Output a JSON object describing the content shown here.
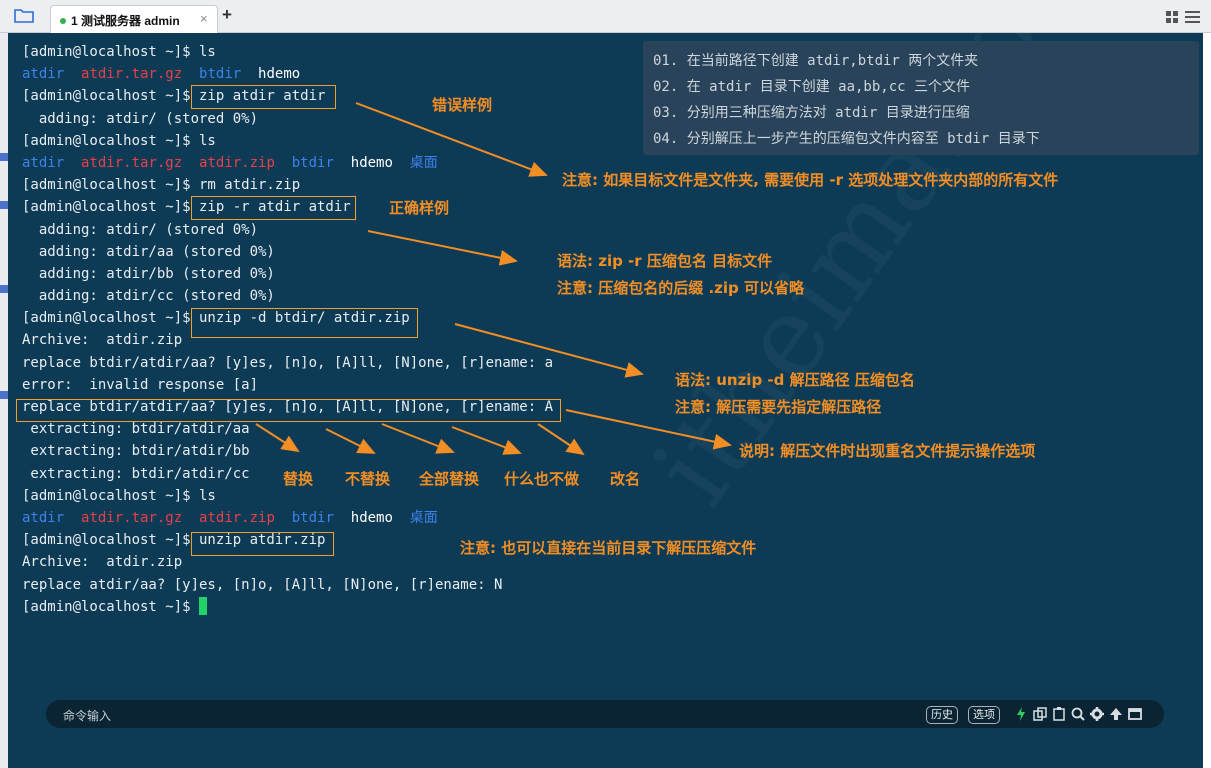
{
  "tabbar": {
    "tab_title": "1 测试服务器 admin",
    "close_symbol": "×",
    "add_symbol": "+"
  },
  "terminal": {
    "lines": [
      [
        {
          "t": "[admin@localhost ~]$ ls"
        }
      ],
      [
        {
          "t": "atdir",
          "c": "blu"
        },
        {
          "t": "  "
        },
        {
          "t": "atdir.tar.gz",
          "c": "red"
        },
        {
          "t": "  "
        },
        {
          "t": "btdir",
          "c": "blu"
        },
        {
          "t": "  "
        },
        {
          "t": "hdemo",
          "c": "wht"
        }
      ],
      [
        {
          "t": "[admin@localhost ~]$ zip atdir atdir"
        }
      ],
      [
        {
          "t": "  adding: atdir/ (stored 0%)"
        }
      ],
      [
        {
          "t": "[admin@localhost ~]$ ls"
        }
      ],
      [
        {
          "t": "atdir",
          "c": "blu"
        },
        {
          "t": "  "
        },
        {
          "t": "atdir.tar.gz",
          "c": "red"
        },
        {
          "t": "  "
        },
        {
          "t": "atdir.zip",
          "c": "red"
        },
        {
          "t": "  "
        },
        {
          "t": "btdir",
          "c": "blu"
        },
        {
          "t": "  "
        },
        {
          "t": "hdemo",
          "c": "wht"
        },
        {
          "t": "  "
        },
        {
          "t": "桌面",
          "c": "blu"
        }
      ],
      [
        {
          "t": "[admin@localhost ~]$ rm atdir.zip"
        }
      ],
      [
        {
          "t": "[admin@localhost ~]$ zip -r atdir atdir"
        }
      ],
      [
        {
          "t": "  adding: atdir/ (stored 0%)"
        }
      ],
      [
        {
          "t": "  adding: atdir/aa (stored 0%)"
        }
      ],
      [
        {
          "t": "  adding: atdir/bb (stored 0%)"
        }
      ],
      [
        {
          "t": "  adding: atdir/cc (stored 0%)"
        }
      ],
      [
        {
          "t": "[admin@localhost ~]$ unzip -d btdir/ atdir.zip"
        }
      ],
      [
        {
          "t": "Archive:  atdir.zip"
        }
      ],
      [
        {
          "t": "replace btdir/atdir/aa? [y]es, [n]o, [A]ll, [N]one, [r]ename: a"
        }
      ],
      [
        {
          "t": "error:  invalid response [a]"
        }
      ],
      [
        {
          "t": "replace btdir/atdir/aa? [y]es, [n]o, [A]ll, [N]one, [r]ename: A"
        }
      ],
      [
        {
          "t": " extracting: btdir/atdir/aa"
        }
      ],
      [
        {
          "t": " extracting: btdir/atdir/bb"
        }
      ],
      [
        {
          "t": " extracting: btdir/atdir/cc"
        }
      ],
      [
        {
          "t": "[admin@localhost ~]$ ls"
        }
      ],
      [
        {
          "t": "atdir",
          "c": "blu"
        },
        {
          "t": "  "
        },
        {
          "t": "atdir.tar.gz",
          "c": "red"
        },
        {
          "t": "  "
        },
        {
          "t": "atdir.zip",
          "c": "red"
        },
        {
          "t": "  "
        },
        {
          "t": "btdir",
          "c": "blu"
        },
        {
          "t": "  "
        },
        {
          "t": "hdemo",
          "c": "wht"
        },
        {
          "t": "  "
        },
        {
          "t": "桌面",
          "c": "blu"
        }
      ],
      [
        {
          "t": "[admin@localhost ~]$ unzip atdir.zip"
        }
      ],
      [
        {
          "t": "Archive:  atdir.zip"
        }
      ],
      [
        {
          "t": "replace atdir/aa? [y]es, [n]o, [A]ll, [N]one, [r]ename: N"
        }
      ],
      [
        {
          "t": "[admin@localhost ~]$ "
        }
      ]
    ]
  },
  "info_box": {
    "lines": [
      "01. 在当前路径下创建 atdir,btdir 两个文件夹",
      "02. 在 atdir 目录下创建 aa,bb,cc 三个文件",
      "03. 分别用三种压缩方法对 atdir 目录进行压缩",
      "04. 分别解压上一步产生的压缩包文件内容至 btdir 目录下"
    ]
  },
  "annotations": {
    "wrong_example": "错误样例",
    "note_folder": "注意: 如果目标文件是文件夹, 需要使用 -r 选项处理文件夹内部的所有文件",
    "correct_example": "正确样例",
    "syntax_zip": "语法: zip -r 压缩包名 目标文件",
    "note_suffix": "注意: 压缩包名的后缀 .zip 可以省略",
    "syntax_unzip": "语法: unzip -d 解压路径 压缩包名",
    "note_path": "注意: 解压需要先指定解压路径",
    "explain_prompt": "说明: 解压文件时出现重名文件提示操作选项",
    "opt_replace": "替换",
    "opt_no_replace": "不替换",
    "opt_replace_all": "全部替换",
    "opt_none": "什么也不做",
    "opt_rename": "改名",
    "note_current_dir": "注意: 也可以直接在当前目录下解压压缩文件"
  },
  "command_bar": {
    "label": "命令输入",
    "history": "历史",
    "options": "选项"
  },
  "colors": {
    "terminal_bg": "#0d3a55",
    "annotation": "#f28e24",
    "cursor": "#22d36a"
  }
}
